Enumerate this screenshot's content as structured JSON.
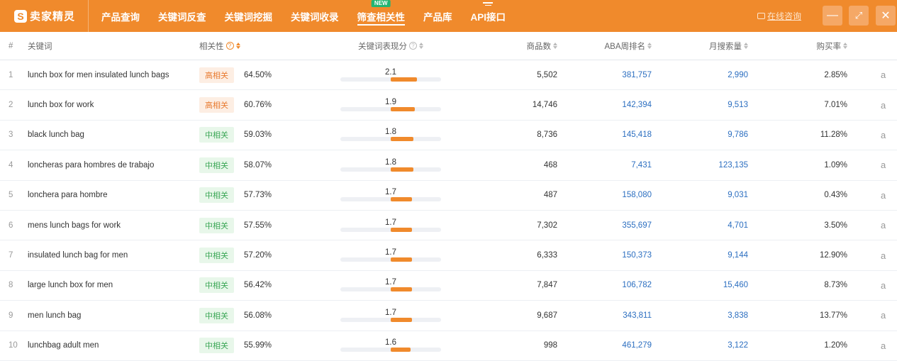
{
  "app": {
    "logo_text": "卖家精灵",
    "logo_glyph": "S"
  },
  "nav": {
    "items": [
      {
        "label": "产品查询"
      },
      {
        "label": "关键词反查"
      },
      {
        "label": "关键词挖掘"
      },
      {
        "label": "关键词收录"
      },
      {
        "label": "筛查相关性",
        "active": true,
        "badge": "NEW"
      },
      {
        "label": "产品库"
      },
      {
        "label": "API接口",
        "menu_icon": "menu-icon"
      }
    ]
  },
  "topright": {
    "consult_label": "在线咨询",
    "minimize_icon": "—",
    "expand_icon": "⤢",
    "close_icon": "✕"
  },
  "colors": {
    "brand": "#f08a2c",
    "link": "#2b6ec0",
    "high_tag": "#e87a2f",
    "mid_tag": "#3aa655"
  },
  "table": {
    "headers": {
      "idx": "#",
      "keyword": "关键词",
      "relevance": "相关性",
      "relevance_help": "?",
      "performance": "关键词表现分",
      "products": "商品数",
      "aba": "ABA周排名",
      "monthly": "月搜索量",
      "purchase": "购买率"
    },
    "rows": [
      {
        "idx": "1",
        "keyword": "lunch box for men insulated lunch bags",
        "tag": "高相关",
        "level": "high",
        "pct": "64.50%",
        "score": "2.1",
        "score_value": 2.1,
        "products": "5,502",
        "aba": "381,757",
        "monthly": "2,990",
        "purchase": "2.85%",
        "amazon": "a"
      },
      {
        "idx": "2",
        "keyword": "lunch box for work",
        "tag": "高相关",
        "level": "high",
        "pct": "60.76%",
        "score": "1.9",
        "score_value": 1.9,
        "products": "14,746",
        "aba": "142,394",
        "monthly": "9,513",
        "purchase": "7.01%",
        "amazon": "a"
      },
      {
        "idx": "3",
        "keyword": "black lunch bag",
        "tag": "中相关",
        "level": "mid",
        "pct": "59.03%",
        "score": "1.8",
        "score_value": 1.8,
        "products": "8,736",
        "aba": "145,418",
        "monthly": "9,786",
        "purchase": "11.28%",
        "amazon": "a"
      },
      {
        "idx": "4",
        "keyword": "loncheras para hombres de trabajo",
        "tag": "中相关",
        "level": "mid",
        "pct": "58.07%",
        "score": "1.8",
        "score_value": 1.8,
        "products": "468",
        "aba": "7,431",
        "monthly": "123,135",
        "purchase": "1.09%",
        "amazon": "a"
      },
      {
        "idx": "5",
        "keyword": "lonchera para hombre",
        "tag": "中相关",
        "level": "mid",
        "pct": "57.73%",
        "score": "1.7",
        "score_value": 1.7,
        "products": "487",
        "aba": "158,080",
        "monthly": "9,031",
        "purchase": "0.43%",
        "amazon": "a"
      },
      {
        "idx": "6",
        "keyword": "mens lunch bags for work",
        "tag": "中相关",
        "level": "mid",
        "pct": "57.55%",
        "score": "1.7",
        "score_value": 1.7,
        "products": "7,302",
        "aba": "355,697",
        "monthly": "4,701",
        "purchase": "3.50%",
        "amazon": "a"
      },
      {
        "idx": "7",
        "keyword": "insulated lunch bag for men",
        "tag": "中相关",
        "level": "mid",
        "pct": "57.20%",
        "score": "1.7",
        "score_value": 1.7,
        "products": "6,333",
        "aba": "150,373",
        "monthly": "9,144",
        "purchase": "12.90%",
        "amazon": "a"
      },
      {
        "idx": "8",
        "keyword": "large lunch box for men",
        "tag": "中相关",
        "level": "mid",
        "pct": "56.42%",
        "score": "1.7",
        "score_value": 1.7,
        "products": "7,847",
        "aba": "106,782",
        "monthly": "15,460",
        "purchase": "8.73%",
        "amazon": "a"
      },
      {
        "idx": "9",
        "keyword": "men lunch bag",
        "tag": "中相关",
        "level": "mid",
        "pct": "56.08%",
        "score": "1.7",
        "score_value": 1.7,
        "products": "9,687",
        "aba": "343,811",
        "monthly": "3,838",
        "purchase": "13.77%",
        "amazon": "a"
      },
      {
        "idx": "10",
        "keyword": "lunchbag adult men",
        "tag": "中相关",
        "level": "mid",
        "pct": "55.99%",
        "score": "1.6",
        "score_value": 1.6,
        "products": "998",
        "aba": "461,279",
        "monthly": "3,122",
        "purchase": "1.20%",
        "amazon": "a"
      }
    ]
  }
}
